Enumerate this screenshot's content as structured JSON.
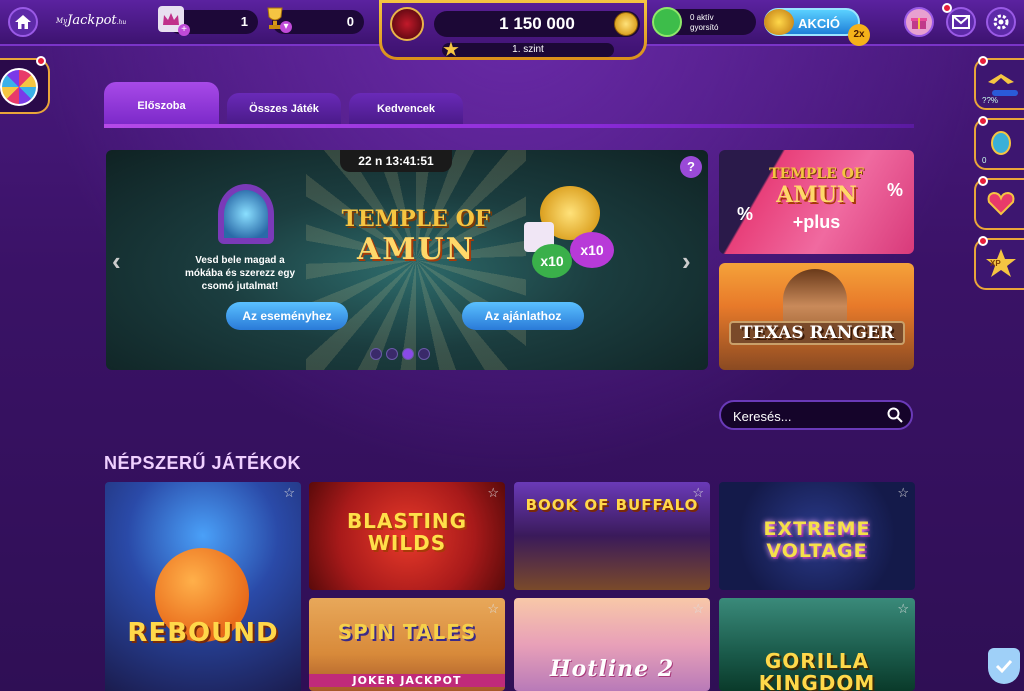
{
  "header": {
    "logo_my": "My",
    "logo_text": "Jackpot",
    "logo_suffix": ".hu",
    "crowns_count": "1",
    "trophies_count": "0",
    "coins": "1 150 000",
    "level": "1. szint",
    "boost_line1": "0 aktív",
    "boost_line2": "gyorsító",
    "akcio_label": "AKCIÓ",
    "akcio_multiplier": "2x"
  },
  "tabs": [
    {
      "label": "Előszoba",
      "active": true
    },
    {
      "label": "Összes Játék",
      "active": false
    },
    {
      "label": "Kedvencek",
      "active": false
    }
  ],
  "banner": {
    "timer": "22 n 13:41:51",
    "help": "?",
    "left_arrow": "‹",
    "right_arrow": "›",
    "promo_text": "Vesd bele magad a mókába és szerezz egy csomó jutalmat!",
    "logo_line1": "TEMPLE OF",
    "logo_line2": "AMUN",
    "prize_multiplier_1": "x10",
    "prize_multiplier_2": "x10",
    "btn_event": "Az eseményhez",
    "btn_offers": "Az ajánlathoz",
    "slides": 4,
    "active_slide": 3
  },
  "side_tiles": [
    {
      "line1": "TEMPLE OF",
      "line2": "AMUN",
      "line3": "+plus"
    },
    {
      "title": "TEXAS RANGER"
    }
  ],
  "right_rail": [
    {
      "caption": "??%"
    },
    {
      "caption": "0"
    },
    {
      "caption": ""
    },
    {
      "caption": "XP"
    }
  ],
  "search": {
    "placeholder": "Keresés..."
  },
  "section_title": "NÉPSZERŰ JÁTÉKOK",
  "games": [
    {
      "title": "REBOUND",
      "fav": "☆"
    },
    {
      "title": "BLASTING WILDS",
      "fav": "☆"
    },
    {
      "title": "BOOK OF BUFFALO",
      "fav": "☆"
    },
    {
      "title": "EXTREME VOLTAGE",
      "fav": "☆"
    },
    {
      "title": "SPIN TALES",
      "subtitle": "JOKER JACKPOT",
      "fav": "☆"
    },
    {
      "title": "Hotline 2",
      "fav": "☆"
    },
    {
      "title": "GORILLA KINGDOM",
      "fav": "☆"
    }
  ],
  "colors": {
    "bg": "#3a1466",
    "accent_gold": "#f5c542",
    "accent_blue": "#2a7ad8",
    "tab_active": "#a84ae8"
  }
}
